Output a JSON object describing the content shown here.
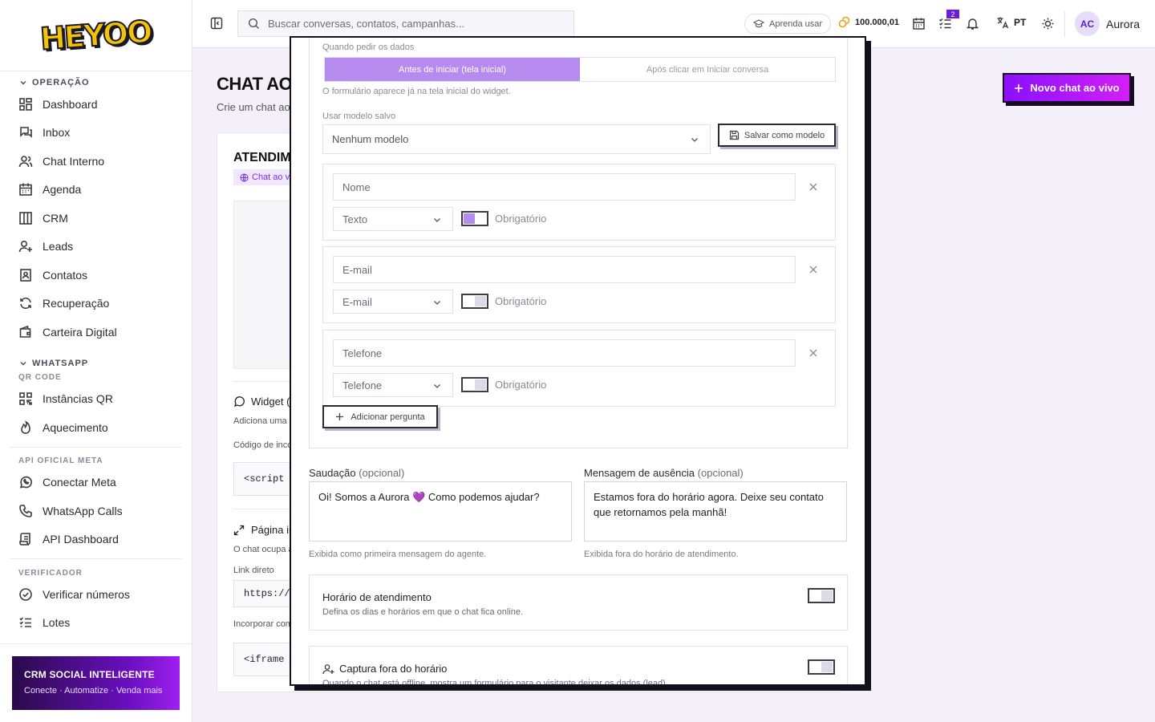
{
  "brand": {
    "logo": "HEYOO"
  },
  "sidebar": {
    "sections": [
      {
        "label": "OPERAÇÃO",
        "collapsible": true,
        "items": [
          {
            "label": "Dashboard",
            "icon": "dashboard-icon"
          },
          {
            "label": "Inbox",
            "icon": "inbox-icon"
          },
          {
            "label": "Chat Interno",
            "icon": "users-icon"
          },
          {
            "label": "Agenda",
            "icon": "calendar-icon"
          },
          {
            "label": "CRM",
            "icon": "kanban-icon"
          },
          {
            "label": "Leads",
            "icon": "user-plus-icon"
          },
          {
            "label": "Contatos",
            "icon": "contact-book-icon"
          },
          {
            "label": "Recuperação",
            "icon": "refresh-icon"
          },
          {
            "label": "Carteira Digital",
            "icon": "wallet-icon"
          }
        ]
      },
      {
        "label": "WHATSAPP",
        "collapsible": true,
        "sublabel": "QR CODE",
        "items": [
          {
            "label": "Instâncias QR",
            "icon": "qr-icon"
          },
          {
            "label": "Aquecimento",
            "icon": "flame-icon"
          }
        ]
      },
      {
        "label": "API OFICIAL META",
        "items": [
          {
            "label": "Conectar Meta",
            "icon": "whatsapp-icon"
          },
          {
            "label": "WhatsApp Calls",
            "icon": "phone-icon"
          },
          {
            "label": "API Dashboard",
            "icon": "scroll-icon"
          }
        ]
      },
      {
        "label": "VERIFICADOR",
        "items": [
          {
            "label": "Verificar números",
            "icon": "check-circle-icon"
          },
          {
            "label": "Lotes",
            "icon": "list-check-icon"
          }
        ]
      }
    ],
    "promo": {
      "title": "CRM SOCIAL INTELIGENTE",
      "subtitle": "Conecte · Automatize · Venda mais"
    }
  },
  "topbar": {
    "search_placeholder": "Buscar conversas, contatos, campanhas...",
    "learn_label": "Aprenda usar",
    "credits": "100.000,01",
    "tasks_badge": "2",
    "language": "PT",
    "user_initials": "AC",
    "user_name": "Aurora"
  },
  "page": {
    "title": "CHAT AO",
    "subtitle": "Crie um chat ao",
    "new_button": "Novo chat ao vivo",
    "card_title": "ATENDIM",
    "card_chip": "Chat ao v",
    "widget_title": "Widget (",
    "widget_desc": "Adiciona uma b",
    "widget_code_label": "Código de inco",
    "widget_code": "<script s",
    "page_title": "Página in",
    "page_desc": "O chat ocupa a",
    "direct_link_label": "Link direto",
    "direct_link": "https://",
    "embed_label": "Incorporar com",
    "embed_code": "<iframe s"
  },
  "modal": {
    "when_label": "Quando pedir os dados",
    "seg_before": "Antes de iniciar (tela inicial)",
    "seg_after": "Após clicar em Iniciar conversa",
    "seg_help": "O formulário aparece já na tela inicial do widget.",
    "template_label": "Usar modelo salvo",
    "template_value": "Nenhum modelo",
    "save_template": "Salvar como modelo",
    "questions": [
      {
        "name": "Nome",
        "type": "Texto",
        "required_label": "Obrigatório",
        "required": true
      },
      {
        "name": "E-mail",
        "type": "E-mail",
        "required_label": "Obrigatório",
        "required": false
      },
      {
        "name": "Telefone",
        "type": "Telefone",
        "required_label": "Obrigatório",
        "required": false
      }
    ],
    "add_question": "Adicionar pergunta",
    "greeting_label": "Saudação",
    "greeting_optional": "(opcional)",
    "greeting_value": "Oi! Somos a Aurora 💜 Como podemos ajudar?",
    "greeting_help": "Exibida como primeira mensagem do agente.",
    "away_label": "Mensagem de ausência",
    "away_optional": "(opcional)",
    "away_value": "Estamos fora do horário agora. Deixe seu contato que retornamos pela manhã!",
    "away_help": "Exibida fora do horário de atendimento.",
    "hours_title": "Horário de atendimento",
    "hours_desc": "Defina os dias e horários em que o chat fica online.",
    "capture_title": "Captura fora do horário",
    "capture_desc": "Quando o chat está offline, mostra um formulário para o visitante deixar os dados (lead)."
  },
  "colors": {
    "accent": "#b68bf0",
    "brand_purple": "#8a10ff",
    "brand_pink": "#d21ff6",
    "logo_yellow": "#f5c20b"
  }
}
